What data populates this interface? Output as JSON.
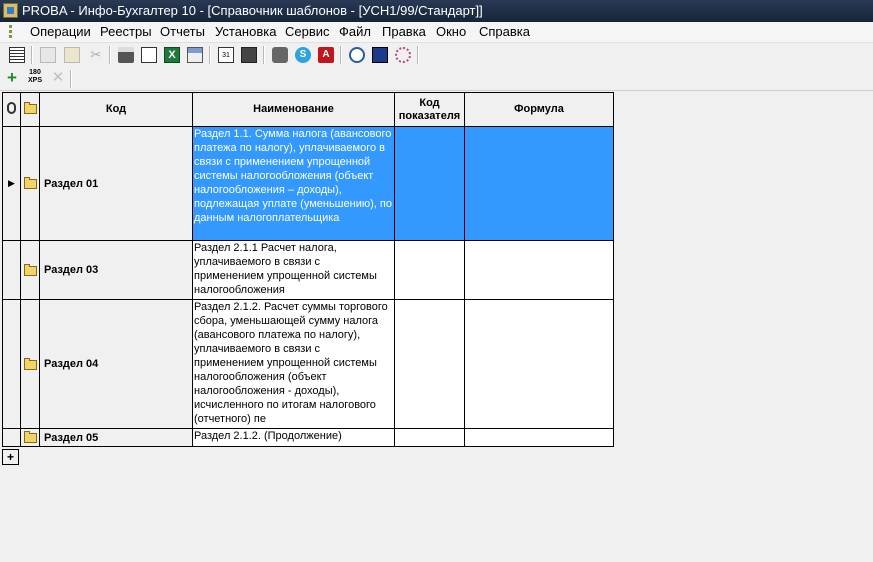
{
  "window": {
    "title": "PROBA - Инфо-Бухгалтер 10 - [Справочник шаблонов - [УСН1/99/Стандарт]]"
  },
  "menu": [
    "Операции",
    "Реестры",
    "Отчеты",
    "Установка",
    "Сервис",
    "Файл",
    "Правка",
    "Окно",
    "Справка"
  ],
  "toolbar_icons": [
    "list-view-icon",
    "copy-icon",
    "paste-icon",
    "cut-icon",
    "excel-icon",
    "print-icon",
    "print-preview-icon",
    "export-excel-icon",
    "report-icon",
    "calendar-icon",
    "calculator-icon",
    "tools-icon",
    "skype-icon",
    "adobe-icon",
    "compass-icon",
    "note-icon",
    "gear-icon"
  ],
  "toolbar2": {
    "add_label": "+",
    "counter_label": "180\nXPS",
    "delete_label": "✕"
  },
  "grid": {
    "columns": {
      "code": "Код",
      "name": "Наименование",
      "kod": "Код показателя",
      "formula": "Формула"
    },
    "rows": [
      {
        "code": "Раздел 01",
        "name": "Раздел 1.1. Сумма налога (авансового платежа по налогу), уплачиваемого в связи с применением упрощенной системы налогообложения (объект налогообложения – доходы), подлежащая уплате (уменьшению), по данным налогоплательщика",
        "kod": "",
        "formula": "",
        "selected": true
      },
      {
        "code": "Раздел 03",
        "name": "Раздел 2.1.1 Расчет налога, уплачиваемого в связи с применением упрощенной системы налогообложения",
        "kod": "",
        "formula": "",
        "selected": false
      },
      {
        "code": "Раздел 04",
        "name": "Раздел 2.1.2. Расчет суммы торгового сбора, уменьшающей сумму налога (авансового платежа по налогу), уплачиваемого в связи с применением упрощенной системы налогообложения (объект налогообложения - доходы), исчисленного по итогам налогового (отчетного) пе",
        "kod": "",
        "formula": "",
        "selected": false
      },
      {
        "code": "Раздел 05",
        "name": "Раздел 2.1.2. (Продолжение)",
        "kod": "",
        "formula": "",
        "selected": false
      }
    ],
    "add_row_label": "+"
  },
  "colors": {
    "selection": "#3399ff",
    "titlebar": "#1f2f4a"
  }
}
